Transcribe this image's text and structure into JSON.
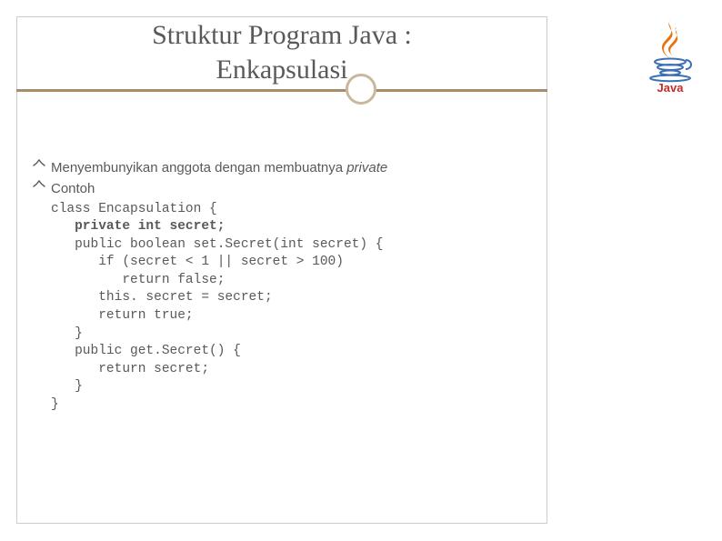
{
  "title_line1": "Struktur Program Java :",
  "title_line2": "Enkapsulasi",
  "bullets": [
    {
      "prefix": "Menyembunyikan anggota dengan membuatnya ",
      "italic": "private"
    },
    {
      "prefix": "Contoh",
      "italic": ""
    }
  ],
  "bullet_glyph": "༏",
  "code": {
    "l1": "class Encapsulation {",
    "l2": "   private int secret;",
    "l3": "   public boolean set.Secret(int secret) {",
    "l4": "      if (secret < 1 || secret > 100)",
    "l5": "         return false;",
    "l6": "      this. secret = secret;",
    "l7": "      return true;",
    "l8": "   }",
    "l9": "   public get.Secret() {",
    "l10": "      return secret;",
    "l11": "   }",
    "l12": "}"
  },
  "logo_text": "Java"
}
